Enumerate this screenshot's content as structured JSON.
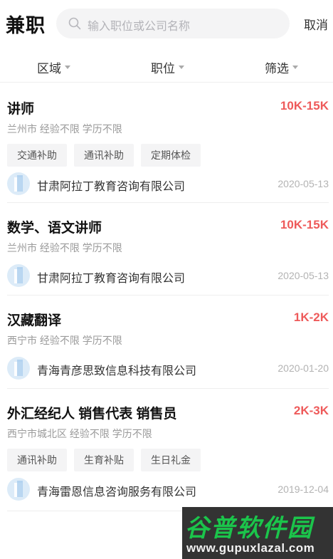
{
  "header": {
    "title": "兼职",
    "search_placeholder": "输入职位或公司名称",
    "cancel_label": "取消"
  },
  "filters": [
    "区域",
    "职位",
    "筛选"
  ],
  "jobs": [
    {
      "title": "讲师",
      "salary": "10K-15K",
      "meta": "兰州市 经验不限 学历不限",
      "tags": [
        "交通补助",
        "通讯补助",
        "定期体检"
      ],
      "company": "甘肃阿拉丁教育咨询有限公司",
      "date": "2020-05-13"
    },
    {
      "title": "数学、语文讲师",
      "salary": "10K-15K",
      "meta": "兰州市 经验不限 学历不限",
      "tags": [],
      "company": "甘肃阿拉丁教育咨询有限公司",
      "date": "2020-05-13"
    },
    {
      "title": "汉藏翻译",
      "salary": "1K-2K",
      "meta": "西宁市 经验不限 学历不限",
      "tags": [],
      "company": "青海青彦思致信息科技有限公司",
      "date": "2020-01-20"
    },
    {
      "title": "外汇经纪人 销售代表 销售员",
      "salary": "2K-3K",
      "meta": "西宁市城北区 经验不限 学历不限",
      "tags": [
        "通讯补助",
        "生育补贴",
        "生日礼金"
      ],
      "company": "青海雷恩信息咨询服务有限公司",
      "date": "2019-12-04"
    }
  ],
  "watermark": {
    "title": "谷普软件园",
    "url": "www.gupuxlazal.com"
  },
  "colors": {
    "salary": "#ee5a5a",
    "search_bg": "#f4f4f5",
    "tag_bg": "#f4f4f5"
  }
}
